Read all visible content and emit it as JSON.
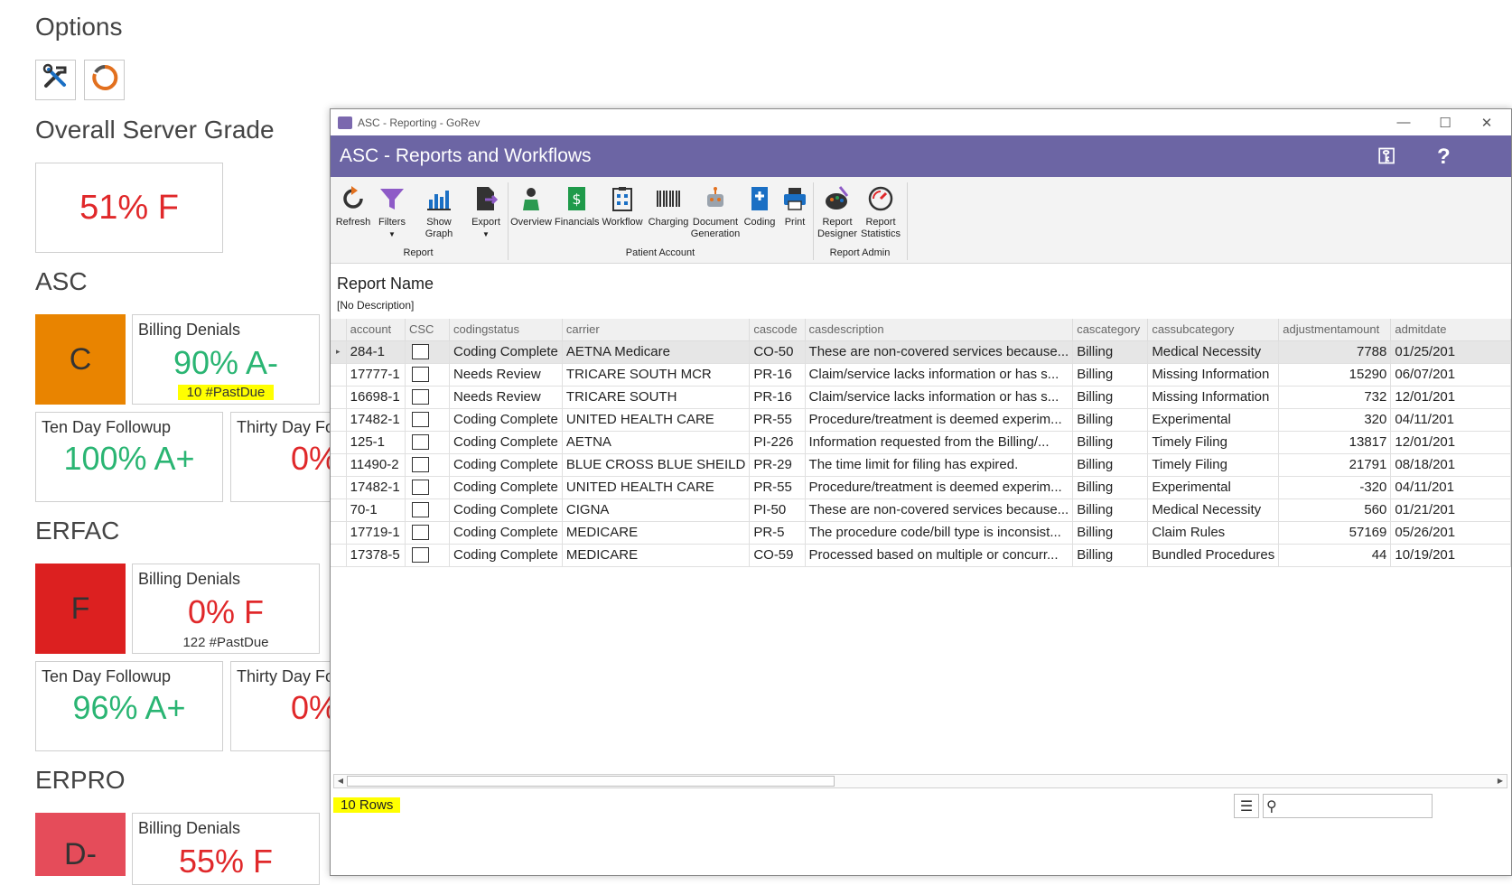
{
  "dashboard": {
    "options_title": "Options",
    "overall_title": "Overall Server Grade",
    "overall_value": "51% F",
    "sections": [
      {
        "name": "ASC",
        "grade": "C",
        "grade_color": "#e98400",
        "billing_title": "Billing Denials",
        "billing_value": "90% A-",
        "billing_sub": "10 #PastDue",
        "ten_title": "Ten Day Followup",
        "ten_value": "100% A+",
        "thirty_title": "Thirty Day Fo",
        "thirty_value": "0%"
      },
      {
        "name": "ERFAC",
        "grade": "F",
        "grade_color": "#dc2020",
        "billing_title": "Billing Denials",
        "billing_value": "0% F",
        "billing_sub": "122 #PastDue",
        "ten_title": "Ten Day Followup",
        "ten_value": "96% A+",
        "thirty_title": "Thirty Day Fo",
        "thirty_value": "0%"
      },
      {
        "name": "ERPRO",
        "grade": "D-",
        "grade_color": "#e54c5a",
        "billing_title": "Billing Denials",
        "billing_value": "55% F"
      }
    ]
  },
  "window": {
    "title": "ASC - Reporting - GoRev",
    "header": "ASC - Reports and Workflows",
    "ribbon": {
      "buttons": [
        "Refresh",
        "Filters",
        "Show Graph",
        "Export",
        "Overview",
        "Financials",
        "Workflow",
        "Charging",
        "Document Generation",
        "Coding",
        "Print",
        "Report Designer",
        "Report Statistics"
      ],
      "groups": [
        "Report",
        "Patient Account",
        "Report Admin"
      ]
    },
    "report_name": "Report Name",
    "report_desc": "[No Description]",
    "columns": [
      "account",
      "CSC",
      "codingstatus",
      "carrier",
      "cascode",
      "casdescription",
      "cascategory",
      "cassubcategory",
      "adjustmentamount",
      "admitdate"
    ],
    "rows": [
      [
        "284-1",
        "",
        "Coding Complete",
        "AETNA Medicare",
        "CO-50",
        "These are non-covered services because...",
        "Billing",
        "Medical Necessity",
        "7788",
        "01/25/201"
      ],
      [
        "17777-1",
        "",
        "Needs Review",
        "TRICARE SOUTH MCR",
        "PR-16",
        "Claim/service lacks information or has s...",
        "Billing",
        "Missing Information",
        "15290",
        "06/07/201"
      ],
      [
        "16698-1",
        "",
        "Needs Review",
        "TRICARE SOUTH",
        "PR-16",
        "Claim/service lacks information or has s...",
        "Billing",
        "Missing Information",
        "732",
        "12/01/201"
      ],
      [
        "17482-1",
        "",
        "Coding Complete",
        "UNITED HEALTH CARE",
        "PR-55",
        "Procedure/treatment is deemed experim...",
        "Billing",
        "Experimental",
        "320",
        "04/11/201"
      ],
      [
        "125-1",
        "",
        "Coding Complete",
        "AETNA",
        "PI-226",
        "Information requested from the Billing/...",
        "Billing",
        "Timely Filing",
        "13817",
        "12/01/201"
      ],
      [
        "11490-2",
        "",
        "Coding Complete",
        "BLUE CROSS BLUE SHEILD",
        "PR-29",
        "The time limit for filing has expired.",
        "Billing",
        "Timely Filing",
        "21791",
        "08/18/201"
      ],
      [
        "17482-1",
        "",
        "Coding Complete",
        "UNITED HEALTH CARE",
        "PR-55",
        "Procedure/treatment is deemed experim...",
        "Billing",
        "Experimental",
        "-320",
        "04/11/201"
      ],
      [
        "70-1",
        "",
        "Coding Complete",
        "CIGNA",
        "PI-50",
        "These are non-covered services because...",
        "Billing",
        "Medical Necessity",
        "560",
        "01/21/201"
      ],
      [
        "17719-1",
        "",
        "Coding Complete",
        "MEDICARE",
        "PR-5",
        "The procedure code/bill type is inconsist...",
        "Billing",
        "Claim Rules",
        "57169",
        "05/26/201"
      ],
      [
        "17378-5",
        "",
        "Coding Complete",
        "MEDICARE",
        "CO-59",
        "Processed based on multiple or concurr...",
        "Billing",
        "Bundled Procedures",
        "44",
        "10/19/201"
      ]
    ],
    "row_count": "10 Rows"
  }
}
